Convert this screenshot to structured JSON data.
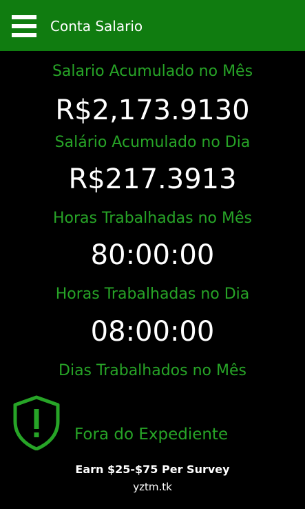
{
  "header": {
    "title": "Conta Salario",
    "menu_icon": "hamburger-menu-icon",
    "background_color": "#107c10"
  },
  "stats": [
    {
      "label": "Salario Acumulado no Mês",
      "value": "R$2,173.9130"
    },
    {
      "label": "Salário Acumulado no Dia",
      "value": "R$217.3913"
    },
    {
      "label": "Horas Trabalhadas no Mês",
      "value": "80:00:00"
    },
    {
      "label": "Horas Trabalhadas no Dia",
      "value": "08:00:00"
    },
    {
      "label": "Dias Trabalhados no Mês",
      "value": ""
    }
  ],
  "status": {
    "icon": "shield-alert-icon",
    "text": "Fora do Expediente"
  },
  "ad": {
    "title": "Earn $25-$75 Per Survey",
    "url": "yztm.tk"
  },
  "colors": {
    "accent": "#27a427",
    "text": "#ffffff",
    "background": "#000000"
  }
}
